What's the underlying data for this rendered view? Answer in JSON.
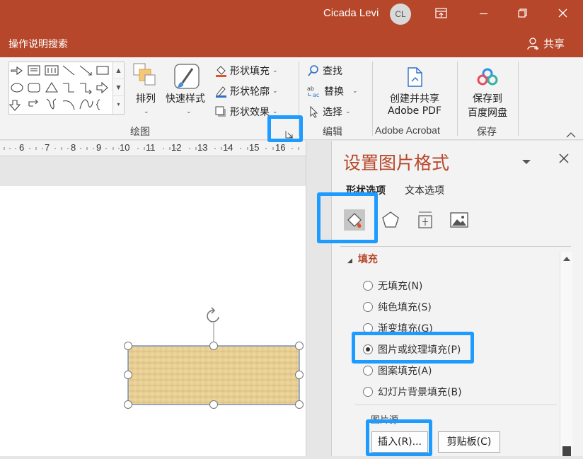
{
  "titlebar": {
    "user_name": "Cicada Levi",
    "avatar_initials": "CL"
  },
  "tellbar": {
    "tell_me": "操作说明搜索",
    "share": "共享"
  },
  "ribbon": {
    "arrange": "排列",
    "quick_styles": "快速样式",
    "shape_fill": "形状填充",
    "shape_outline": "形状轮廓",
    "shape_effects": "形状效果",
    "drawing_group": "绘图",
    "find": "查找",
    "replace": "替换",
    "select": "选择",
    "editing_group": "编辑",
    "create_share_line1": "创建并共享",
    "create_share_line2": "Adobe PDF",
    "acrobat_group": "Adobe Acrobat",
    "save_to_line1": "保存到",
    "save_to_line2": "百度网盘",
    "save_group": "保存"
  },
  "ruler": {
    "ticks": [
      "6",
      "7",
      "8",
      "9",
      "10",
      "11",
      "12",
      "13",
      "14",
      "15",
      "16"
    ]
  },
  "pane": {
    "title": "设置图片格式",
    "tab_shape_options": "形状选项",
    "tab_text_options": "文本选项",
    "section_fill": "填充",
    "fill_options": [
      {
        "label": "无填充(N)",
        "checked": false
      },
      {
        "label": "纯色填充(S)",
        "checked": false
      },
      {
        "label": "渐变填充(G)",
        "checked": false
      },
      {
        "label": "图片或纹理填充(P)",
        "checked": true
      },
      {
        "label": "图案填充(A)",
        "checked": false
      },
      {
        "label": "幻灯片背景填充(B)",
        "checked": false
      }
    ],
    "picture_source": "图片源",
    "insert_button": "插入(R)...",
    "clipboard_button": "剪贴板(C)"
  },
  "colors": {
    "accent": "#b7472a",
    "highlight": "#1e9bff"
  }
}
